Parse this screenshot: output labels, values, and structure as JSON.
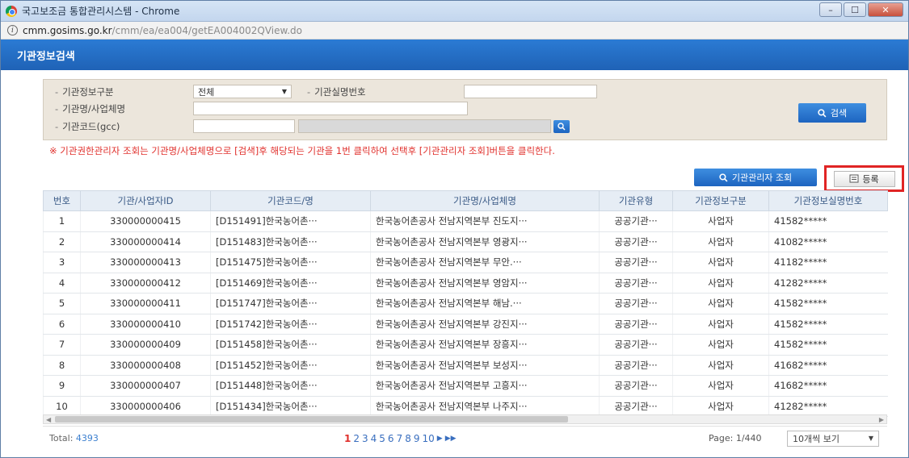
{
  "window": {
    "title": "국고보조금 통합관리시스템 - Chrome",
    "url_host": "cmm.gosims.go.kr",
    "url_path": "/cmm/ea/ea004/getEA004002QView.do"
  },
  "header": {
    "title": "기관정보검색"
  },
  "search": {
    "label_type": "기관정보구분",
    "select_value": "전체",
    "label_realname": "기관실명번호",
    "label_name": "기관명/사업체명",
    "label_code": "기관코드(gcc)",
    "search_button": "검색"
  },
  "notice": "※ 기관권한관리자 조회는 기관명/사업체명으로 [검색]후 해당되는 기관을 1번 클릭하여 선택후 [기관관리자 조회]버튼을 클릭한다.",
  "actions": {
    "admin_lookup": "기관관리자 조회",
    "register": "등록"
  },
  "table": {
    "headers": [
      "번호",
      "기관/사업자ID",
      "기관코드/명",
      "기관명/사업체명",
      "기관유형",
      "기관정보구분",
      "기관정보실명번호"
    ],
    "rows": [
      [
        "1",
        "330000000415",
        "[D151491]한국농어촌···",
        "한국농어촌공사 전남지역본부 진도지···",
        "공공기관···",
        "사업자",
        "41582*****"
      ],
      [
        "2",
        "330000000414",
        "[D151483]한국농어촌···",
        "한국농어촌공사 전남지역본부 영광지···",
        "공공기관···",
        "사업자",
        "41082*****"
      ],
      [
        "3",
        "330000000413",
        "[D151475]한국농어촌···",
        "한국농어촌공사 전남지역본부 무안.···",
        "공공기관···",
        "사업자",
        "41182*****"
      ],
      [
        "4",
        "330000000412",
        "[D151469]한국농어촌···",
        "한국농어촌공사 전남지역본부 영암지···",
        "공공기관···",
        "사업자",
        "41282*****"
      ],
      [
        "5",
        "330000000411",
        "[D151747]한국농어촌···",
        "한국농어촌공사 전남지역본부 해남.···",
        "공공기관···",
        "사업자",
        "41582*****"
      ],
      [
        "6",
        "330000000410",
        "[D151742]한국농어촌···",
        "한국농어촌공사 전남지역본부 강진지···",
        "공공기관···",
        "사업자",
        "41582*****"
      ],
      [
        "7",
        "330000000409",
        "[D151458]한국농어촌···",
        "한국농어촌공사 전남지역본부 장흥지···",
        "공공기관···",
        "사업자",
        "41582*****"
      ],
      [
        "8",
        "330000000408",
        "[D151452]한국농어촌···",
        "한국농어촌공사 전남지역본부 보성지···",
        "공공기관···",
        "사업자",
        "41682*****"
      ],
      [
        "9",
        "330000000407",
        "[D151448]한국농어촌···",
        "한국농어촌공사 전남지역본부 고흥지···",
        "공공기관···",
        "사업자",
        "41682*****"
      ],
      [
        "10",
        "330000000406",
        "[D151434]한국농어촌···",
        "한국농어촌공사 전남지역본부 나주지···",
        "공공기관···",
        "사업자",
        "41282*****"
      ]
    ]
  },
  "footer": {
    "total_label": "Total:",
    "total_value": "4393",
    "pages": [
      "1",
      "2",
      "3",
      "4",
      "5",
      "6",
      "7",
      "8",
      "9",
      "10"
    ],
    "page_info": "Page: 1/440",
    "page_size": "10개씩 보기"
  },
  "colors": {
    "accent": "#1f62b6",
    "notice": "#e0302c",
    "highlight_border": "#e02424"
  }
}
